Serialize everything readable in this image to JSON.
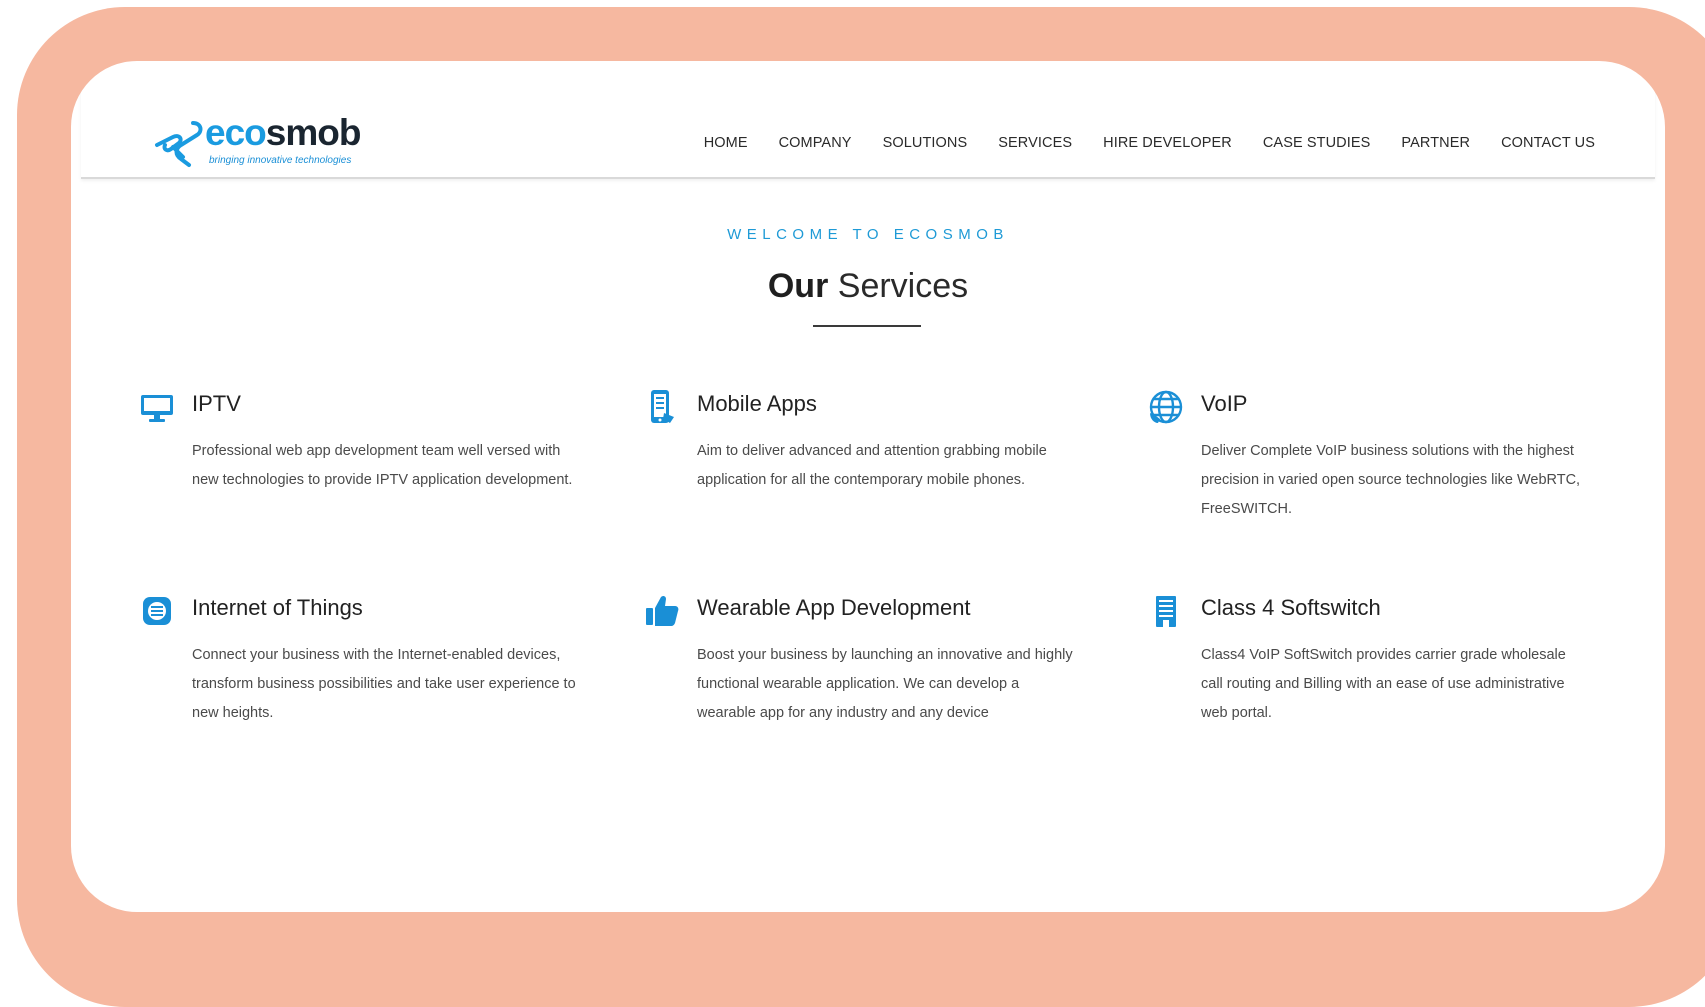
{
  "brand": {
    "name_part1": "eco",
    "name_part2": "smob",
    "tagline": "bringing innovative technologies",
    "accent_color": "#1a9be0",
    "frame_color": "#f6b8a0"
  },
  "nav": {
    "items": [
      {
        "label": "HOME"
      },
      {
        "label": "COMPANY"
      },
      {
        "label": "SOLUTIONS"
      },
      {
        "label": "SERVICES"
      },
      {
        "label": "HIRE DEVELOPER"
      },
      {
        "label": "CASE STUDIES"
      },
      {
        "label": "PARTNER"
      },
      {
        "label": "CONTACT US"
      }
    ]
  },
  "intro": {
    "eyebrow": "WELCOME TO ECOSMOB",
    "title_bold": "Our",
    "title_light": "Services"
  },
  "services": [
    {
      "icon": "monitor-icon",
      "title": "IPTV",
      "description": "Professional web app development team well versed with new technologies to provide IPTV application development."
    },
    {
      "icon": "mobile-phone-icon",
      "title": "Mobile Apps",
      "description": "Aim to deliver advanced and attention grabbing mobile application for all the contemporary mobile phones."
    },
    {
      "icon": "globe-icon",
      "title": "VoIP",
      "description": "Deliver Complete VoIP business solutions with the highest precision in varied open source technologies like WebRTC, FreeSWITCH."
    },
    {
      "icon": "iot-icon",
      "title": "Internet of Things",
      "description": "Connect your business with the Internet-enabled devices, transform business possibilities and take user experience to new heights."
    },
    {
      "icon": "thumbs-up-icon",
      "title": "Wearable App Development",
      "description": "Boost your business by launching an innovative and highly functional wearable application. We can develop a wearable app for any industry and any device"
    },
    {
      "icon": "building-icon",
      "title": "Class 4 Softswitch",
      "description": "Class4 VoIP SoftSwitch provides carrier grade wholesale call routing and Billing with an ease of use administrative web portal."
    }
  ]
}
